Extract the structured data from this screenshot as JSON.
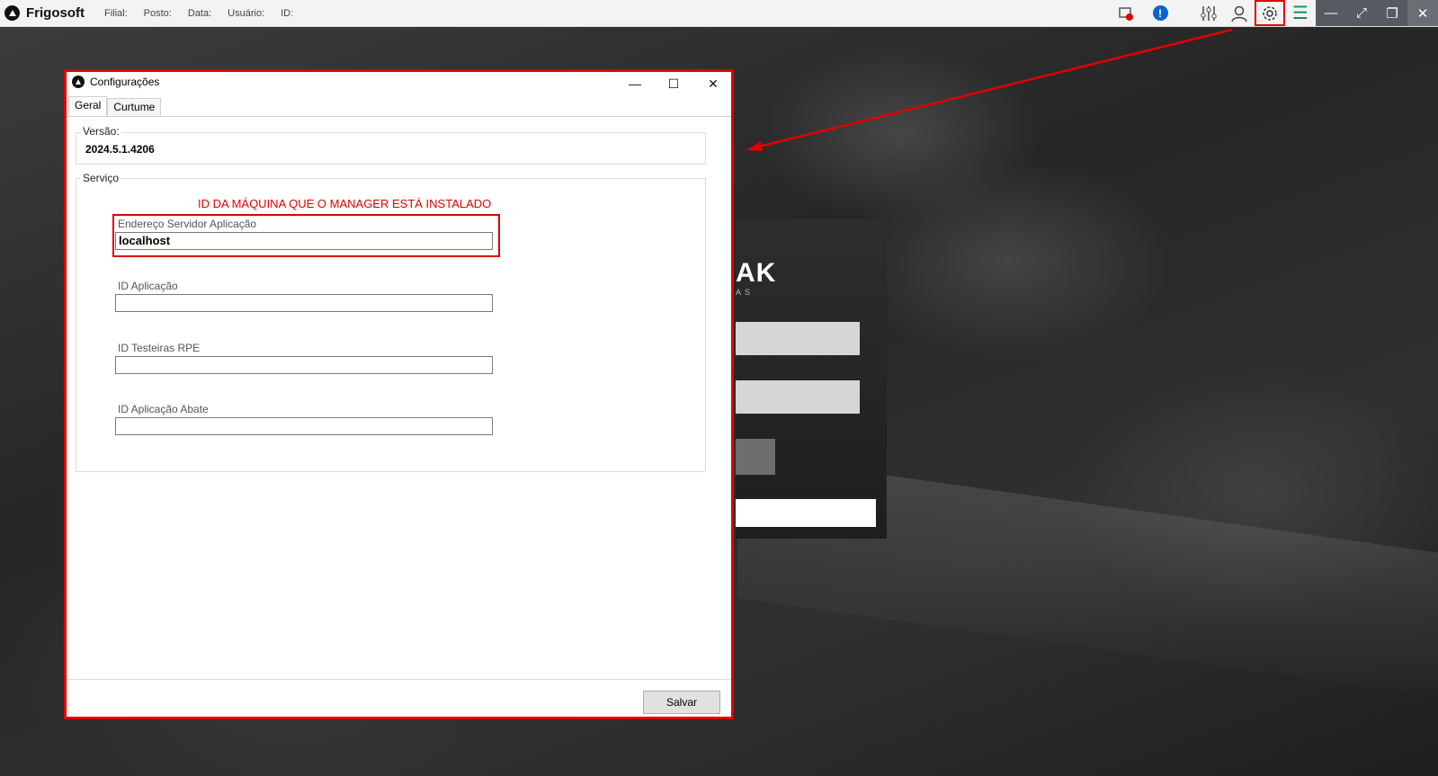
{
  "app": {
    "title": "Frigosoft",
    "meta": [
      "Filial:",
      "Posto:",
      "Data:",
      "Usuário:",
      "ID:"
    ]
  },
  "toolbar": {
    "icons": [
      "camera-alert-icon",
      "info-alert-icon",
      "sliders-icon",
      "user-icon",
      "gear-icon",
      "menu-icon"
    ],
    "window": [
      "minimize",
      "fit-screen",
      "restore",
      "close"
    ]
  },
  "login_panel": {
    "logo": "AK",
    "sub": "AS"
  },
  "dialog": {
    "title": "Configurações",
    "tabs": [
      "Geral",
      "Curtume"
    ],
    "active_tab": "Geral",
    "version_label": "Versão:",
    "version_value": "2024.5.1.4206",
    "service_label": "Serviço",
    "annotation": "ID DA MÁQUINA QUE O MANAGER ESTÁ INSTALADO",
    "fields": [
      {
        "label": "Endereço Servidor Aplicação",
        "value": "localhost"
      },
      {
        "label": "ID Aplicação",
        "value": ""
      },
      {
        "label": "ID Testeiras RPE",
        "value": ""
      },
      {
        "label": "ID Aplicação Abate",
        "value": ""
      }
    ],
    "save_label": "Salvar"
  },
  "colors": {
    "highlight": "#e20000",
    "info": "#0a63d1",
    "menu": "#1a8c5a"
  }
}
